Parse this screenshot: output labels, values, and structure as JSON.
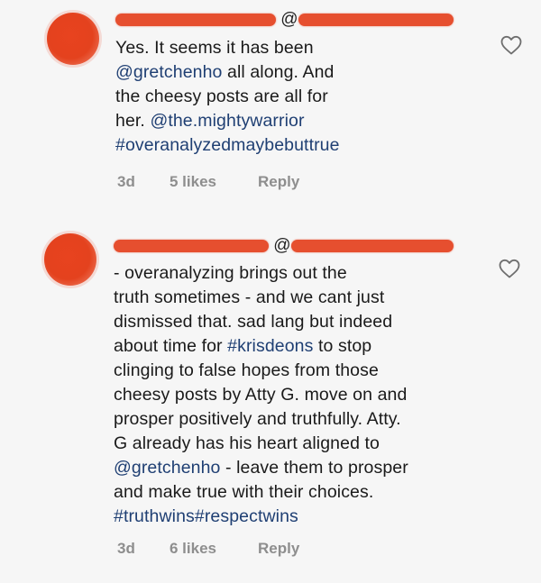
{
  "comments": [
    {
      "at_symbol": "@",
      "text_lines": [
        {
          "parts": [
            {
              "t": "Yes. It seems it has been",
              "link": false
            }
          ]
        },
        {
          "parts": [
            {
              "t": "@gretchenho",
              "link": true
            },
            {
              "t": " all along. And",
              "link": false
            }
          ]
        },
        {
          "parts": [
            {
              "t": "the cheesy posts are all for",
              "link": false
            }
          ]
        },
        {
          "parts": [
            {
              "t": "her. ",
              "link": false
            },
            {
              "t": "@the.mightywarrior",
              "link": true
            }
          ]
        },
        {
          "parts": [
            {
              "t": "#overanalyzedmaybebuttrue",
              "link": true
            }
          ]
        }
      ],
      "time": "3d",
      "likes": "5 likes",
      "reply": "Reply",
      "like_icon": "heart-outline-icon"
    },
    {
      "at_symbol": "@",
      "text_lines": [
        {
          "parts": [
            {
              "t": "- overanalyzing brings out the",
              "link": false
            }
          ]
        },
        {
          "parts": [
            {
              "t": "truth sometimes - and we cant just",
              "link": false
            }
          ]
        },
        {
          "parts": [
            {
              "t": "dismissed that. sad lang but indeed",
              "link": false
            }
          ]
        },
        {
          "parts": [
            {
              "t": "about time for ",
              "link": false
            },
            {
              "t": "#krisdeons",
              "link": true
            },
            {
              "t": " to stop",
              "link": false
            }
          ]
        },
        {
          "parts": [
            {
              "t": "clinging to false hopes from those",
              "link": false
            }
          ]
        },
        {
          "parts": [
            {
              "t": "cheesy posts by Atty G.  move on and",
              "link": false
            }
          ]
        },
        {
          "parts": [
            {
              "t": "prosper positively and truthfully. Atty.",
              "link": false
            }
          ]
        },
        {
          "parts": [
            {
              "t": "G already has his heart aligned to",
              "link": false
            }
          ]
        },
        {
          "parts": [
            {
              "t": "@gretchenho",
              "link": true
            },
            {
              "t": " - leave them to prosper",
              "link": false
            }
          ]
        },
        {
          "parts": [
            {
              "t": "and make true with their choices.",
              "link": false
            }
          ]
        },
        {
          "parts": [
            {
              "t": "#truthwins#respectwins",
              "link": true
            }
          ]
        }
      ],
      "time": "3d",
      "likes": "6 likes",
      "reply": "Reply",
      "like_icon": "heart-outline-icon"
    }
  ],
  "colors": {
    "avatar": "#e5411f",
    "redaction": "#e5411f",
    "link": "#1f3f73",
    "meta": "#8e8e8e",
    "background": "#f6f6f6"
  }
}
